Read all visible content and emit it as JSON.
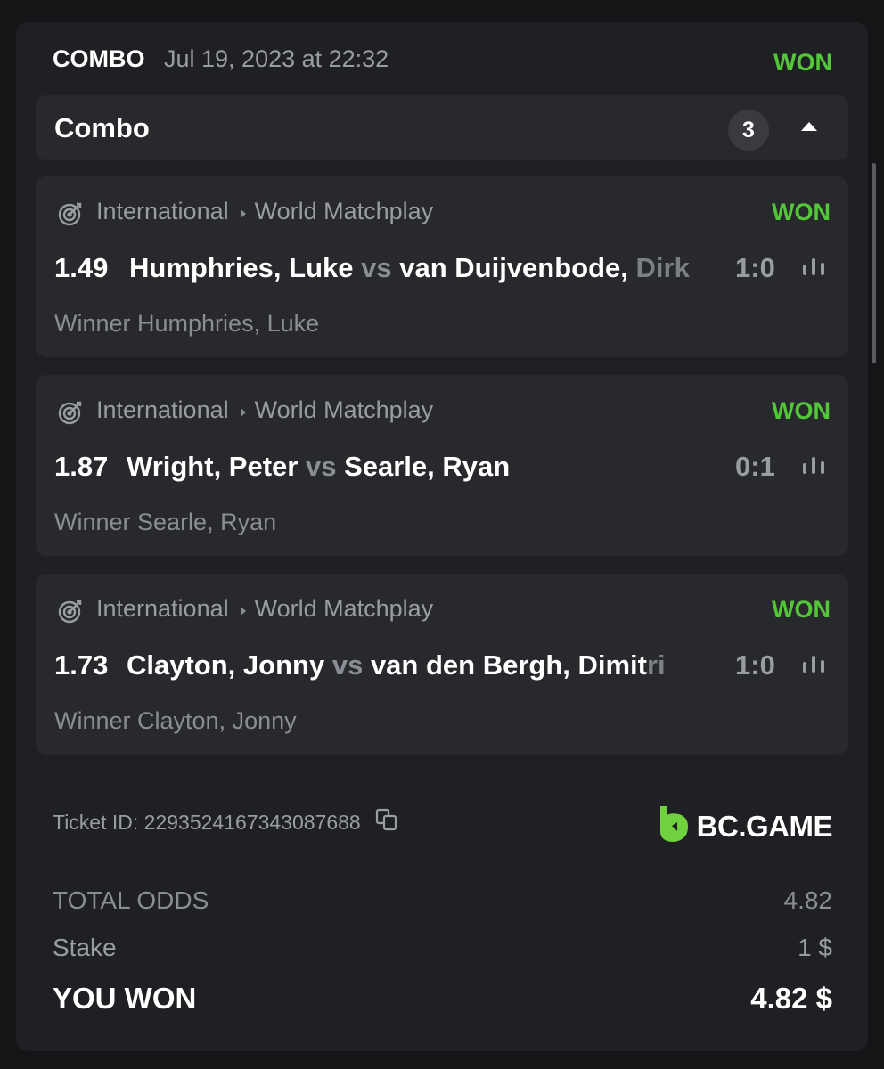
{
  "header": {
    "bet_type": "COMBO",
    "date": "Jul 19, 2023 at 22:32",
    "status": "WON"
  },
  "combo": {
    "title": "Combo",
    "count": "3"
  },
  "legs": [
    {
      "league": "International",
      "tournament": "World Matchplay",
      "status": "WON",
      "odds": "1.49",
      "home": "Humphries, Luke",
      "vs": "vs",
      "away": "van Duijvenbode,",
      "away_faded": " Dirk",
      "score": "1:0",
      "pick": "Winner Humphries, Luke"
    },
    {
      "league": "International",
      "tournament": "World Matchplay",
      "status": "WON",
      "odds": "1.87",
      "home": "Wright, Peter",
      "vs": "vs",
      "away": "Searle, Ryan",
      "away_faded": "",
      "score": "0:1",
      "pick": "Winner Searle, Ryan"
    },
    {
      "league": "International",
      "tournament": "World Matchplay",
      "status": "WON",
      "odds": "1.73",
      "home": "Clayton, Jonny",
      "vs": "vs",
      "away": "van den Bergh, Dimit",
      "away_faded": "ri",
      "score": "1:0",
      "pick": "Winner Clayton, Jonny"
    }
  ],
  "ticket": {
    "label": "Ticket ID: 2293524167343087688",
    "brand": "BC.GAME"
  },
  "summary": {
    "total_odds_label": "TOTAL ODDS",
    "total_odds_value": "4.82",
    "stake_label": "Stake",
    "stake_value": "1 $",
    "won_label": "YOU WON",
    "won_value": "4.82 $"
  },
  "colors": {
    "won_green": "#54c63a",
    "card_bg": "#1f2023",
    "leg_bg": "#28292d",
    "brand_green": "#6fd23e"
  },
  "icons": [
    "dart-target-icon",
    "caret-right-icon",
    "stats-bars-icon",
    "chevron-up-icon",
    "copy-icon",
    "bc-game-logo-icon"
  ]
}
